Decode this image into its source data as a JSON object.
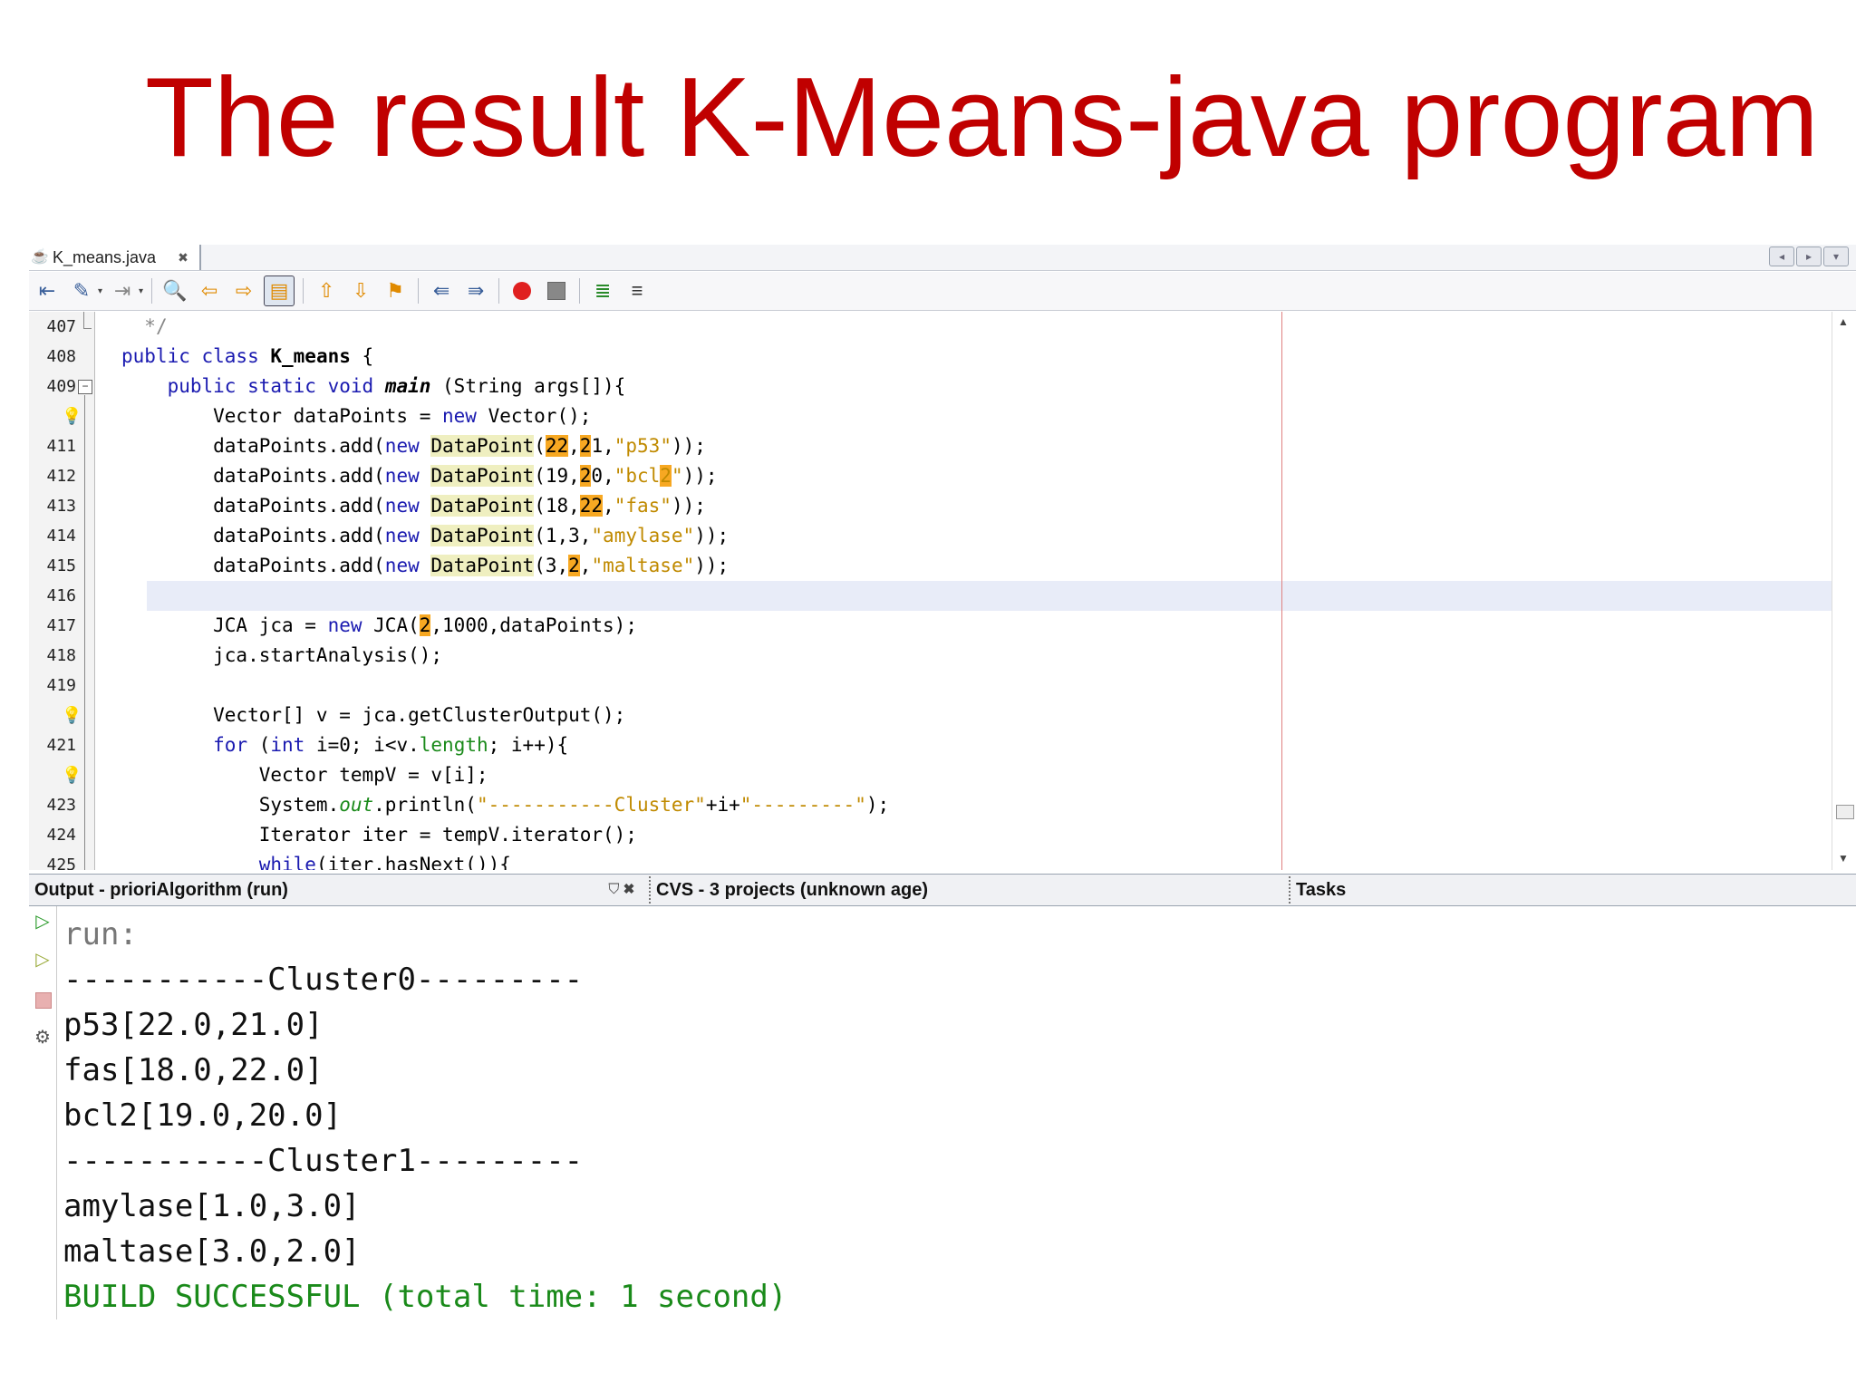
{
  "slide": {
    "title": "The result K-Means-java program"
  },
  "editor": {
    "tab_label": "K_means.java",
    "tab_close": "✖",
    "lines": [
      {
        "num": "407",
        "hint": false,
        "html": "  <span class=\"cm\">*/</span>"
      },
      {
        "num": "408",
        "hint": false,
        "html": "<span class=\"kw\">public class</span> <b>K_means</b> {"
      },
      {
        "num": "409",
        "hint": false,
        "html": "    <span class=\"kw\">public static void</span> <b class=\"it\">main</b> (String args[]){"
      },
      {
        "num": "",
        "hint": true,
        "html": "        Vector dataPoints = <span class=\"kw\">new</span> Vector();"
      },
      {
        "num": "411",
        "hint": false,
        "html": "        dataPoints.add(<span class=\"kw\">new</span> <span class=\"hl-yel\">DataPoint</span>(<span class=\"hl-or\">22</span>,<span class=\"hl-or\">2</span>1,<span class=\"str\">\"p53\"</span>));"
      },
      {
        "num": "412",
        "hint": false,
        "html": "        dataPoints.add(<span class=\"kw\">new</span> <span class=\"hl-yel\">DataPoint</span>(19,<span class=\"hl-or\">2</span>0,<span class=\"str\">\"bcl<span class=\"hl-or\">2</span>\"</span>));"
      },
      {
        "num": "413",
        "hint": false,
        "html": "        dataPoints.add(<span class=\"kw\">new</span> <span class=\"hl-yel\">DataPoint</span>(18,<span class=\"hl-or\">22</span>,<span class=\"str\">\"fas\"</span>));"
      },
      {
        "num": "414",
        "hint": false,
        "html": "        dataPoints.add(<span class=\"kw\">new</span> <span class=\"hl-yel\">DataPoint</span>(1,3,<span class=\"str\">\"amylase\"</span>));"
      },
      {
        "num": "415",
        "hint": false,
        "html": "        dataPoints.add(<span class=\"kw\">new</span> <span class=\"hl-yel\">DataPoint</span>(3,<span class=\"hl-or\">2</span>,<span class=\"str\">\"maltase\"</span>));"
      },
      {
        "num": "416",
        "hint": false,
        "html": ""
      },
      {
        "num": "417",
        "hint": false,
        "html": "        JCA jca = <span class=\"kw\">new</span> JCA(<span class=\"hl-or\">2</span>,1000,dataPoints);"
      },
      {
        "num": "418",
        "hint": false,
        "html": "        jca.startAnalysis();"
      },
      {
        "num": "419",
        "hint": false,
        "html": ""
      },
      {
        "num": "",
        "hint": true,
        "html": "        Vector[] v = jca.getClusterOutput();"
      },
      {
        "num": "421",
        "hint": false,
        "html": "        <span class=\"kw\">for</span> (<span class=\"kw\">int</span> i=0; i&lt;v.<span class=\"fld\">length</span>; i++){"
      },
      {
        "num": "",
        "hint": true,
        "html": "            Vector tempV = v[i];"
      },
      {
        "num": "423",
        "hint": false,
        "html": "            System.<span class=\"fld it\">out</span>.println(<span class=\"str\">\"-----------Cluster\"</span>+i+<span class=\"str\">\"---------\"</span>);"
      },
      {
        "num": "424",
        "hint": false,
        "html": "            Iterator iter = tempV.iterator();"
      },
      {
        "num": "425",
        "hint": false,
        "html": "            <span class=\"kw\">while</span>(iter.hasNext()){"
      }
    ]
  },
  "output_panel": {
    "tab_output": "Output - prioriAlgorithm (run)",
    "tab_cvs": "CVS - 3 projects (unknown age)",
    "tab_tasks": "Tasks",
    "lines": [
      "run:",
      "-----------Cluster0---------",
      "p53[22.0,21.0]",
      "fas[18.0,22.0]",
      "bcl2[19.0,20.0]",
      "-----------Cluster1---------",
      "amylase[1.0,3.0]",
      "maltase[3.0,2.0]",
      "BUILD SUCCESSFUL (total time: 1 second)"
    ]
  },
  "icons": {
    "hint": "💡",
    "run": "▷"
  }
}
